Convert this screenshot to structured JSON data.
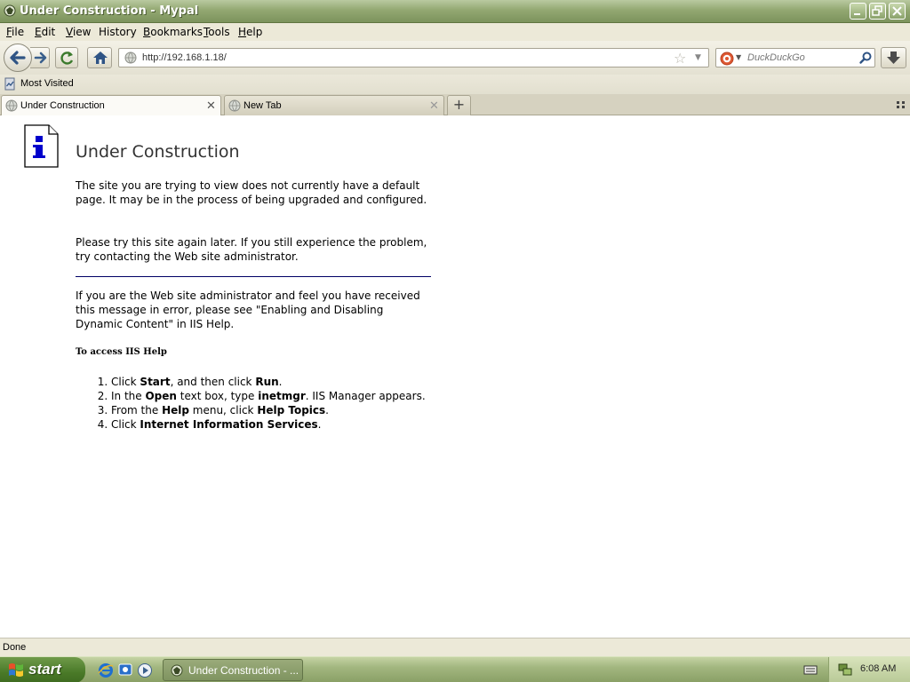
{
  "window": {
    "title": "Under Construction - Mypal"
  },
  "menubar": {
    "items": [
      {
        "label": "File",
        "key": "F",
        "rest": "ile"
      },
      {
        "label": "Edit",
        "key": "E",
        "rest": "dit"
      },
      {
        "label": "View",
        "key": "V",
        "rest": "iew"
      },
      {
        "label": "History",
        "key": "",
        "rest": "History"
      },
      {
        "label": "Bookmarks",
        "key": "B",
        "rest": "ookmarks"
      },
      {
        "label": "Tools",
        "key": "T",
        "rest": "ools"
      },
      {
        "label": "Help",
        "key": "H",
        "rest": "elp"
      }
    ]
  },
  "navbar": {
    "url": "http://192.168.1.18/",
    "search_placeholder": "DuckDuckGo"
  },
  "bookmarks": {
    "items": [
      {
        "label": "Most Visited"
      }
    ]
  },
  "tabs": [
    {
      "label": "Under Construction",
      "selected": true
    },
    {
      "label": "New Tab",
      "selected": false
    }
  ],
  "page": {
    "heading": "Under Construction",
    "para1": "The site you are trying to view does not currently have a default page. It may be in the process of being upgraded and configured.",
    "para2": "Please try this site again later. If you still experience the problem, try contacting the Web site administrator.",
    "para3": "If you are the Web site administrator and feel you have received this message in error, please see \"Enabling and Disabling Dynamic Content\" in IIS Help.",
    "help_heading": "To access IIS Help",
    "steps": [
      [
        {
          "t": "Click "
        },
        {
          "b": "Start"
        },
        {
          "t": ", and then click "
        },
        {
          "b": "Run"
        },
        {
          "t": "."
        }
      ],
      [
        {
          "t": "In the "
        },
        {
          "b": "Open"
        },
        {
          "t": " text box, type "
        },
        {
          "b": "inetmgr"
        },
        {
          "t": ". IIS Manager appears."
        }
      ],
      [
        {
          "t": "From the "
        },
        {
          "b": "Help"
        },
        {
          "t": " menu, click "
        },
        {
          "b": "Help Topics"
        },
        {
          "t": "."
        }
      ],
      [
        {
          "t": "Click "
        },
        {
          "b": "Internet Information Services"
        },
        {
          "t": "."
        }
      ]
    ]
  },
  "statusbar": {
    "text": "Done"
  },
  "taskbar": {
    "start_label": "start",
    "task_label": "Under Construction - ...",
    "clock": "6:08 AM"
  },
  "colors": {
    "titlebar": "#93a872",
    "taskbar": "#a3b780",
    "start_button": "#4a7a28",
    "rule": "#000066"
  }
}
